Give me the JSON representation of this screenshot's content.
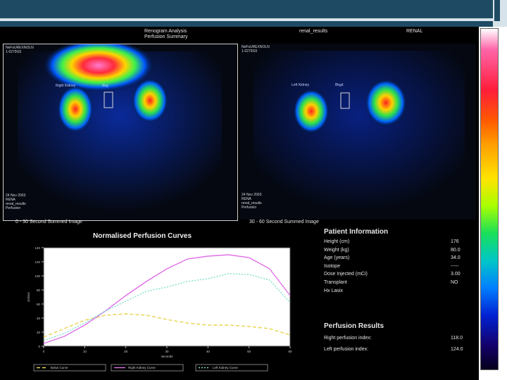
{
  "header": {
    "study_line1": "Renogram Analysis",
    "study_line2": "Perfusion Summary",
    "protocol": "renal_results",
    "department": "RENAL"
  },
  "scans": [
    {
      "meta_top": "NeFsUREXNOLN\n1-0279G5",
      "meta_bottom": "24 Nov 2003\nRENA\nrenal_results\nPerfusion",
      "caption": "0 - 30 Second Summed Image",
      "labels": [
        "Right Kidney",
        "Bkg"
      ]
    },
    {
      "meta_top": "NeFsUREXNOLN\n1-0279G5",
      "meta_bottom": "24 Nov 2003\nRENA\nrenal_results\nPerfusion",
      "caption": "30 - 60 Second Summed Image",
      "labels": [
        "Left Kidney",
        "Bkgd"
      ]
    }
  ],
  "chart_data": {
    "type": "line",
    "title": "Normalised Perfusion Curves",
    "xlabel": "seconds",
    "ylabel": "cts/sec",
    "xlim": [
      0,
      60
    ],
    "ylim": [
      0,
      140
    ],
    "xticks": [
      0,
      10,
      20,
      30,
      40,
      50,
      60
    ],
    "yticks": [
      0,
      20,
      40,
      60,
      80,
      100,
      120,
      140
    ],
    "series": [
      {
        "name": "Bolus Curve",
        "color": "#e8d44d",
        "dash": "5,3",
        "x": [
          0,
          5,
          10,
          15,
          20,
          25,
          30,
          35,
          40,
          45,
          50,
          55,
          60
        ],
        "y": [
          13,
          25,
          37,
          44,
          46,
          44,
          38,
          33,
          30,
          30,
          28,
          25,
          16
        ]
      },
      {
        "name": "Right Kidney Curve",
        "color": "#e070e8",
        "dash": "",
        "x": [
          0,
          5,
          10,
          15,
          20,
          25,
          30,
          35,
          40,
          45,
          50,
          55,
          60
        ],
        "y": [
          4,
          14,
          30,
          50,
          72,
          92,
          110,
          124,
          128,
          130,
          126,
          110,
          72
        ]
      },
      {
        "name": "Left Kidney Curve",
        "color": "#7fe0cc",
        "dash": "2,2",
        "x": [
          0,
          5,
          10,
          15,
          20,
          25,
          30,
          35,
          40,
          45,
          50,
          55,
          60
        ],
        "y": [
          8,
          18,
          33,
          50,
          64,
          78,
          84,
          92,
          96,
          103,
          102,
          94,
          62
        ]
      }
    ]
  },
  "patient": {
    "title": "Patient Information",
    "rows": [
      {
        "label": "Height (cm)",
        "value": "176"
      },
      {
        "label": "Weight (kg)",
        "value": "80.0"
      },
      {
        "label": "Age (years)",
        "value": "34.0"
      },
      {
        "label": "Isotope",
        "value": "-----"
      },
      {
        "label": "Dose Injected (mCi)",
        "value": "3.00"
      },
      {
        "label": "Transplant",
        "value": "NO"
      },
      {
        "label": "Hx Lasix",
        "value": ""
      }
    ]
  },
  "perfusion": {
    "title": "Perfusion Results",
    "rows": [
      {
        "label": "Right perfusion index:",
        "value": "118.0"
      },
      {
        "label": "Left perfusion index:",
        "value": "124.0"
      }
    ]
  },
  "colors": {
    "accent": "#1e4b63",
    "background": "#000000"
  }
}
